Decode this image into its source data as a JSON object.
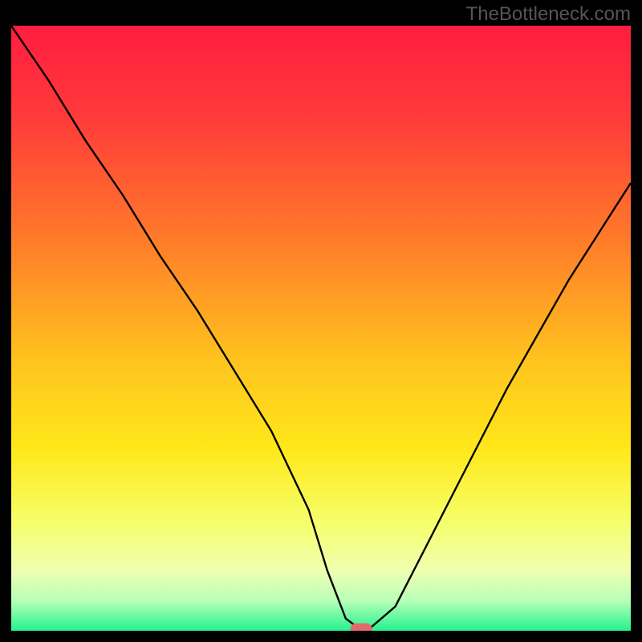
{
  "watermark": "TheBottleneck.com",
  "chart_data": {
    "type": "line",
    "title": "",
    "xlabel": "",
    "ylabel": "",
    "xlim": [
      0,
      100
    ],
    "ylim": [
      0,
      100
    ],
    "background_gradient": {
      "stops": [
        {
          "offset": 0,
          "color": "#ff1d3f"
        },
        {
          "offset": 15,
          "color": "#ff3a3a"
        },
        {
          "offset": 35,
          "color": "#ff7a2a"
        },
        {
          "offset": 55,
          "color": "#ffc21e"
        },
        {
          "offset": 70,
          "color": "#ffe81a"
        },
        {
          "offset": 82,
          "color": "#f6ff6a"
        },
        {
          "offset": 90,
          "color": "#f0ffb0"
        },
        {
          "offset": 95,
          "color": "#b8ffb8"
        },
        {
          "offset": 100,
          "color": "#25f28f"
        }
      ]
    },
    "series": [
      {
        "name": "bottleneck-curve",
        "type": "line",
        "color": "#000000",
        "x": [
          0,
          6,
          12,
          18,
          24,
          30,
          36,
          42,
          48,
          51,
          54,
          56,
          58,
          62,
          66,
          72,
          80,
          90,
          100
        ],
        "y": [
          100,
          91,
          81,
          72,
          62,
          53,
          43,
          33,
          20,
          10,
          2,
          0.5,
          0.5,
          4,
          12,
          24,
          40,
          58,
          74
        ]
      }
    ],
    "marker": {
      "name": "optimal-point",
      "x": 56.5,
      "y": 0.3,
      "color": "#e26a6a",
      "shape": "pill"
    }
  }
}
